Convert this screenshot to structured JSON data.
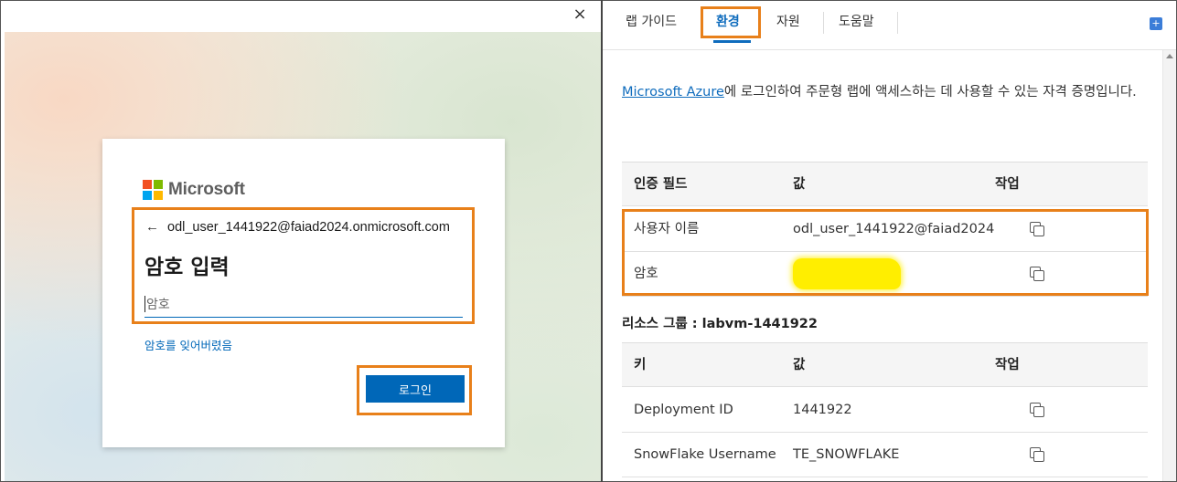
{
  "left_pane": {
    "close_glyph": "×",
    "brand": {
      "name": "Microsoft",
      "logo_colors": [
        "#f25022",
        "#7fba00",
        "#00a4ef",
        "#ffb900"
      ]
    },
    "back_glyph": "←",
    "identity": "odl_user_1441922@faiad2024.onmicrosoft.com",
    "title": "암호 입력",
    "password_placeholder": "암호",
    "forgot_link": "암호를 잊어버렸음",
    "signin_button": "로그인",
    "accent_color": "#0067b8"
  },
  "right_pane": {
    "tabs": [
      {
        "label": "랩 가이드",
        "active": false
      },
      {
        "label": "환경",
        "active": true
      },
      {
        "label": "자원",
        "active": false
      },
      {
        "label": "도움말",
        "active": false
      }
    ],
    "intro": {
      "link_text": "Microsoft Azure",
      "text": "에 로그인하여 주문형 랩에 액세스하는 데 사용할 수 있는 자격 증명입니다."
    },
    "credentials_table": {
      "headers": [
        "인증 필드",
        "값",
        "작업"
      ],
      "rows": [
        {
          "field": "사용자 이름",
          "value": "odl_user_1441922@faiad2024",
          "action_icon": "copy-icon"
        },
        {
          "field": "암호",
          "value": "",
          "redacted": true,
          "action_icon": "copy-icon"
        }
      ]
    },
    "resource_group_label": "리소스 그룹 : labvm-1441922",
    "resource_table": {
      "headers": [
        "키",
        "값",
        "작업"
      ],
      "rows": [
        {
          "key": "Deployment ID",
          "value": "1441922",
          "action_icon": "copy-icon"
        },
        {
          "key": "SnowFlake Username",
          "value": "TE_SNOWFLAKE",
          "action_icon": "copy-icon"
        }
      ]
    },
    "highlight_color": "#e8801a"
  }
}
